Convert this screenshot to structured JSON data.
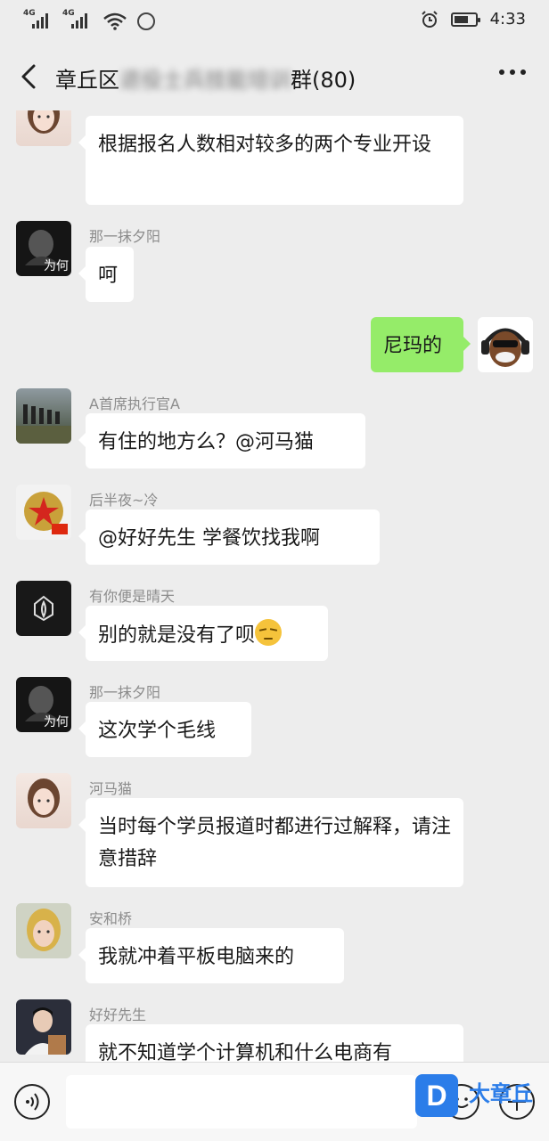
{
  "status_bar": {
    "signal1_label": "4G",
    "signal2_label": "4G",
    "time": "4:33"
  },
  "header": {
    "title_visible": "章丘区",
    "title_blurred": "退役士兵技能培训",
    "title_suffix": "群(80)"
  },
  "messages": [
    {
      "sender": "",
      "text": "根据报名人数相对较多的两个专业开设",
      "avatar_icon": "girl-avatar-icon"
    },
    {
      "sender": "那一抹夕阳",
      "text": "呵",
      "avatar_icon": "dark-portrait-avatar-icon",
      "avatar_caption": "为何"
    },
    {
      "sender": "",
      "text": "尼玛的",
      "self": true,
      "avatar_icon": "gorilla-headphones-avatar-icon"
    },
    {
      "sender": "A首席执行官A",
      "text": "有住的地方么？@河马猫",
      "avatar_icon": "soldiers-avatar-icon"
    },
    {
      "sender": "后半夜~冷",
      "text": "@好好先生  学餐饮找我啊",
      "avatar_icon": "army-emblem-avatar-icon"
    },
    {
      "sender": "有你便是晴天",
      "text": "别的就是没有了呗",
      "avatar_icon": "lotus-logo-avatar-icon",
      "emoji": "unamused-emoji"
    },
    {
      "sender": "那一抹夕阳",
      "text": "这次学个毛线",
      "avatar_icon": "dark-portrait-avatar-icon",
      "avatar_caption": "为何"
    },
    {
      "sender": "河马猫",
      "text": "当时每个学员报道时都进行过解释，请注意措辞",
      "avatar_icon": "girl-avatar-icon"
    },
    {
      "sender": "安和桥",
      "text": "我就冲着平板电脑来的",
      "avatar_icon": "woman-photo-avatar-icon"
    },
    {
      "sender": "好好先生",
      "text": "就不知道学个计算机和什么电商有",
      "avatar_icon": "young-man-avatar-icon"
    }
  ],
  "input_bar": {
    "placeholder": "",
    "watermark_logo": "D",
    "watermark_text": "大章丘"
  },
  "colors": {
    "background": "#ededed",
    "self_bubble": "#95ec69",
    "other_bubble": "#ffffff",
    "name_text": "#8c8c8c",
    "watermark_blue": "#2b7de9"
  }
}
